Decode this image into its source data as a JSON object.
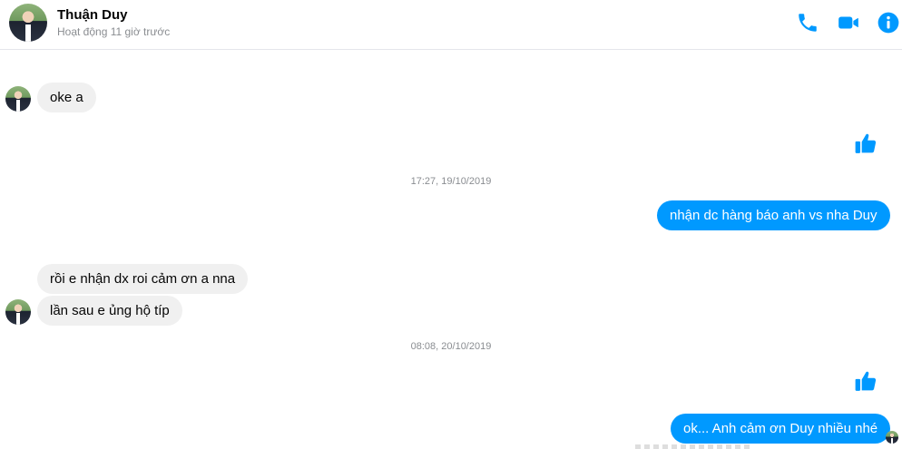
{
  "header": {
    "contact_name": "Thuận Duy",
    "status": "Hoạt động 11 giờ trước",
    "icons": [
      "phone-icon",
      "video-camera-icon",
      "info-icon"
    ],
    "accent_color": "#0099ff"
  },
  "messages": {
    "m1": "oke a",
    "ts1": "17:27, 19/10/2019",
    "m2": "nhận dc hàng báo anh vs nha Duy",
    "m3": "rồi e nhận dx roi cảm ơn a nna",
    "m4": "lần sau e ủng hộ típ",
    "ts2": "08:08, 20/10/2019",
    "m5": "ok... Anh cảm ơn Duy nhiều nhé"
  },
  "colors": {
    "outgoing_bubble": "#0099ff",
    "incoming_bubble": "#f0f0f0",
    "timestamp": "#8a8d91"
  }
}
